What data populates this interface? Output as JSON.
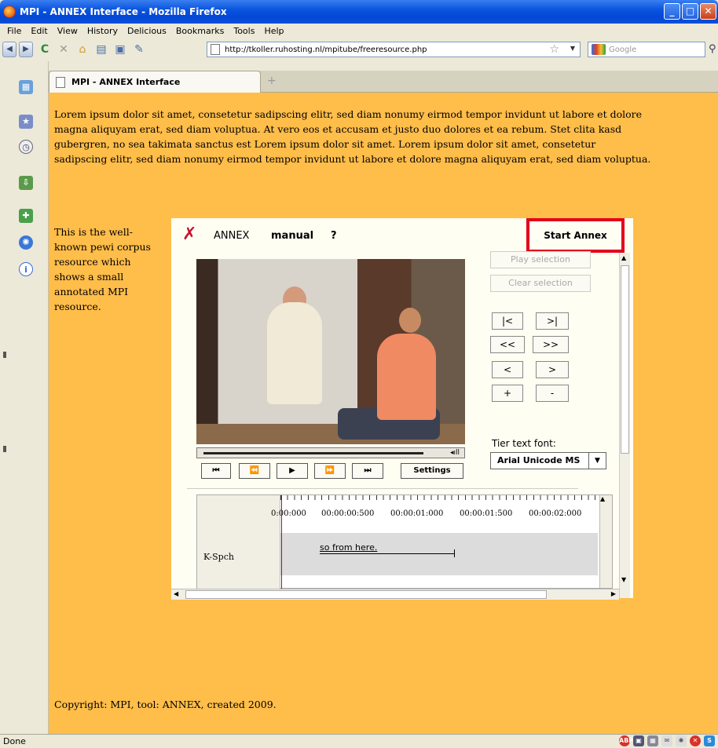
{
  "window": {
    "title": "MPI - ANNEX Interface - Mozilla Firefox"
  },
  "menu": [
    "File",
    "Edit",
    "View",
    "History",
    "Delicious",
    "Bookmarks",
    "Tools",
    "Help"
  ],
  "nav": {
    "url": "http://tkoller.ruhosting.nl/mpitube/freeresource.php",
    "search_placeholder": "Google"
  },
  "tab": {
    "label": "MPI - ANNEX Interface"
  },
  "page": {
    "lorem": "Lorem ipsum dolor sit amet, consetetur sadipscing elitr, sed diam nonumy eirmod tempor invidunt ut labore et dolore magna aliquyam erat, sed diam voluptua. At vero eos et accusam et justo duo dolores et ea rebum. Stet clita kasd gubergren, no sea takimata sanctus est Lorem ipsum dolor sit amet. Lorem ipsum dolor sit amet, consetetur sadipscing elitr, sed diam nonumy eirmod tempor invidunt ut labore et dolore magna aliquyam erat, sed diam voluptua.",
    "side_text": "This is the well-known pewi corpus resource which shows a small annotated MPI resource.",
    "copyright": "Copyright: MPI, tool: ANNEX, created 2009."
  },
  "annex": {
    "title": "ANNEX",
    "manual": "manual",
    "help": "?",
    "start": "Start Annex",
    "play_selection": "Play selection",
    "clear_selection": "Clear selection",
    "nav_buttons": [
      "|<",
      ">|",
      "<<",
      ">>",
      "<",
      ">",
      "+",
      "-"
    ],
    "media_controls": [
      "⏮",
      "⏪",
      "▶",
      "⏩",
      "⏭"
    ],
    "settings": "Settings",
    "tier_font_label": "Tier text font:",
    "tier_font_value": "Arial Unicode MS",
    "ticks": [
      "0:00:000",
      "00:00:00:500",
      "00:00:01:000",
      "00:00:01:500",
      "00:00:02:000"
    ],
    "tier_name": "K-Spch",
    "annotation": "so from here."
  },
  "status": {
    "text": "Done"
  },
  "colors": {
    "page_bg": "#ffbd4a",
    "highlight": "#e3001b"
  }
}
